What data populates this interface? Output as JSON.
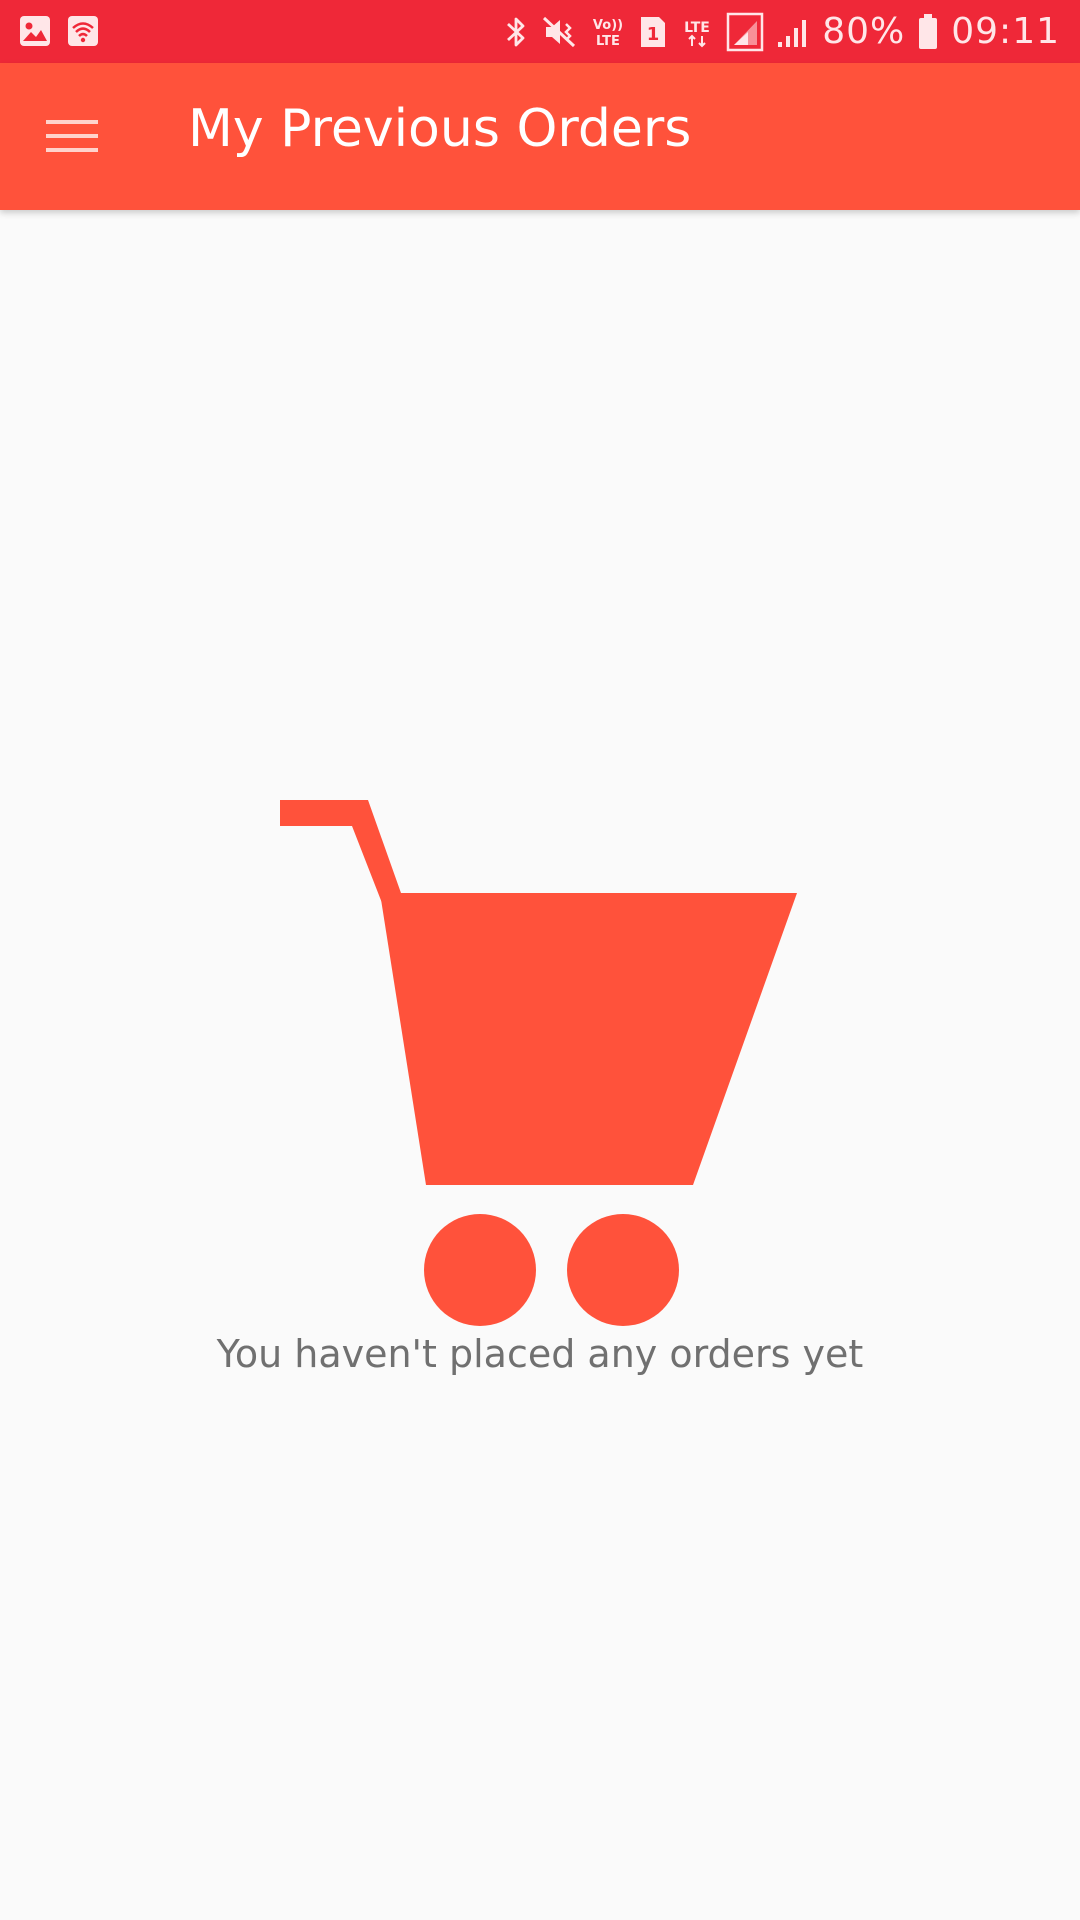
{
  "status_bar": {
    "battery_percent": "80%",
    "time": "09:11",
    "sim_label": "1",
    "icons": [
      "image-icon",
      "wifi-icon",
      "bluetooth-icon",
      "vibrate-icon",
      "volte-icon",
      "sim-icon",
      "lte-icon",
      "signal-icon",
      "signal-icon",
      "battery-icon"
    ]
  },
  "app_bar": {
    "title": "My Previous Orders",
    "menu_icon": "hamburger-menu-icon"
  },
  "empty_state": {
    "illustration": "shopping-cart-icon",
    "message": "You haven't placed any orders yet"
  },
  "colors": {
    "status_bar": "#ef2838",
    "app_bar": "#ff523b",
    "accent": "#ff523b",
    "background": "#fafafa",
    "message_text": "#707070"
  }
}
